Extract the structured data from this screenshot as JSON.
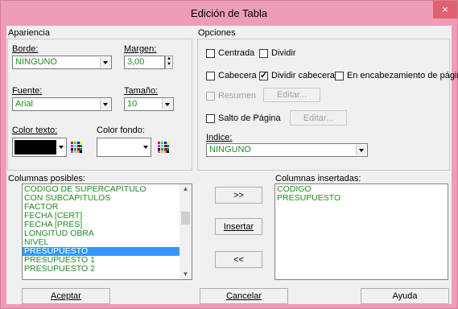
{
  "window": {
    "title": "Edición de Tabla",
    "close_glyph": "×"
  },
  "apariencia": {
    "group_label": "Apariencia",
    "borde_label": "Borde:",
    "borde_value": "NINGUNO",
    "margen_label": "Margen:",
    "margen_value": "3,00",
    "fuente_label": "Fuente:",
    "fuente_value": "Arial",
    "tamano_label": "Tamaño:",
    "tamano_value": "10",
    "color_texto_label": "Color texto:",
    "color_texto_value": "#000000",
    "color_fondo_label": "Color fondo:",
    "color_fondo_value": "#ffffff"
  },
  "opciones": {
    "group_label": "Opciones",
    "centrada": {
      "label": "Centrada",
      "checked": false
    },
    "dividir": {
      "label": "Dividir",
      "checked": false
    },
    "cabecera": {
      "label": "Cabecera",
      "checked": false
    },
    "dividir_cabecera": {
      "label": "Dividir cabecera",
      "checked": true
    },
    "encabezamiento": {
      "label": "En encabezamiento de página",
      "checked": false
    },
    "resumen": {
      "label": "Resumen",
      "checked": false,
      "disabled": true
    },
    "editar1_label": "Editar...",
    "salto_pagina": {
      "label": "Salto de Página",
      "checked": false
    },
    "editar2_label": "Editar...",
    "indice_label": "Indice:",
    "indice_value": "NINGUNO"
  },
  "columnas_posibles": {
    "label": "Columnas posibles:",
    "items": [
      "CODIGO DE SUPERCAPITULO",
      "CON SUBCAPITULOS",
      "FACTOR",
      "FECHA [CERT]",
      "FECHA [PRES]",
      "LONGITUD OBRA",
      "NIVEL",
      "PRESUPUESTO",
      "PRESUPUESTO 1",
      "PRESUPUESTO 2"
    ],
    "selected": "PRESUPUESTO"
  },
  "columnas_insertadas": {
    "label": "Columnas insertadas:",
    "items": [
      "CODIGO",
      "PRESUPUESTO"
    ]
  },
  "middle_buttons": {
    "add_all": ">>",
    "insert": "Insertar",
    "remove_all": "<<"
  },
  "footer": {
    "aceptar": "Aceptar",
    "cancelar": "Cancelar",
    "ayuda": "Ayuda"
  },
  "colors": {
    "accent_text": "#228b22",
    "selection": "#3399ff",
    "title_bg": "#ee9db6",
    "close_bg": "#e0616f"
  }
}
